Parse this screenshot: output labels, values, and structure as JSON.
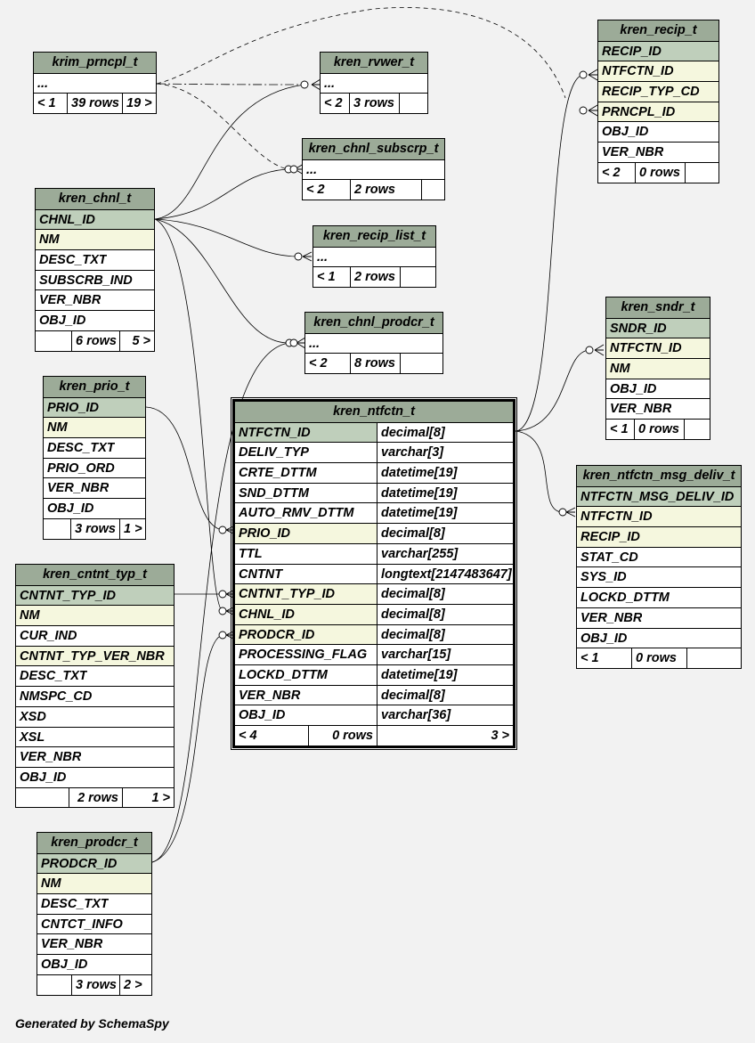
{
  "footer": "Generated by SchemaSpy",
  "tables": {
    "krim_prncpl_t": {
      "name": "krim_prncpl_t",
      "rows": [
        "..."
      ],
      "footer": [
        "< 1",
        "39 rows",
        "19 >"
      ]
    },
    "kren_rvwer_t": {
      "name": "kren_rvwer_t",
      "rows": [
        "..."
      ],
      "footer": [
        "< 2",
        "3 rows",
        ""
      ]
    },
    "kren_chnl_subscrp_t": {
      "name": "kren_chnl_subscrp_t",
      "rows": [
        "..."
      ],
      "footer": [
        "< 2",
        "2 rows",
        ""
      ]
    },
    "kren_recip_list_t": {
      "name": "kren_recip_list_t",
      "rows": [
        "..."
      ],
      "footer": [
        "< 1",
        "2 rows",
        ""
      ]
    },
    "kren_chnl_prodcr_t": {
      "name": "kren_chnl_prodcr_t",
      "rows": [
        "..."
      ],
      "footer": [
        "< 2",
        "8 rows",
        ""
      ]
    },
    "kren_recip_t": {
      "name": "kren_recip_t",
      "rows": [
        "RECIP_ID",
        "NTFCTN_ID",
        "RECIP_TYP_CD",
        "PRNCPL_ID",
        "OBJ_ID",
        "VER_NBR"
      ],
      "footer": [
        "< 2",
        "0 rows",
        ""
      ]
    },
    "kren_chnl_t": {
      "name": "kren_chnl_t",
      "rows": [
        "CHNL_ID",
        "NM",
        "DESC_TXT",
        "SUBSCRB_IND",
        "VER_NBR",
        "OBJ_ID"
      ],
      "footer": [
        "",
        "6 rows",
        "5 >"
      ]
    },
    "kren_sndr_t": {
      "name": "kren_sndr_t",
      "rows": [
        "SNDR_ID",
        "NTFCTN_ID",
        "NM",
        "OBJ_ID",
        "VER_NBR"
      ],
      "footer": [
        "< 1",
        "0 rows",
        ""
      ]
    },
    "kren_prio_t": {
      "name": "kren_prio_t",
      "rows": [
        "PRIO_ID",
        "NM",
        "DESC_TXT",
        "PRIO_ORD",
        "VER_NBR",
        "OBJ_ID"
      ],
      "footer": [
        "",
        "3 rows",
        "1 >"
      ]
    },
    "kren_ntfctn_t": {
      "name": "kren_ntfctn_t",
      "rows": [
        "NTFCTN_ID",
        "DELIV_TYP",
        "CRTE_DTTM",
        "SND_DTTM",
        "AUTO_RMV_DTTM",
        "PRIO_ID",
        "TTL",
        "CNTNT",
        "CNTNT_TYP_ID",
        "CHNL_ID",
        "PRODCR_ID",
        "PROCESSING_FLAG",
        "LOCKD_DTTM",
        "VER_NBR",
        "OBJ_ID"
      ],
      "types": [
        "decimal[8]",
        "varchar[3]",
        "datetime[19]",
        "datetime[19]",
        "datetime[19]",
        "decimal[8]",
        "varchar[255]",
        "longtext[2147483647]",
        "decimal[8]",
        "decimal[8]",
        "decimal[8]",
        "varchar[15]",
        "datetime[19]",
        "decimal[8]",
        "varchar[36]"
      ],
      "footer": [
        "< 4",
        "0 rows",
        "3 >"
      ]
    },
    "kren_ntfctn_msg_deliv_t": {
      "name": "kren_ntfctn_msg_deliv_t",
      "rows": [
        "NTFCTN_MSG_DELIV_ID",
        "NTFCTN_ID",
        "RECIP_ID",
        "STAT_CD",
        "SYS_ID",
        "LOCKD_DTTM",
        "VER_NBR",
        "OBJ_ID"
      ],
      "footer": [
        "< 1",
        "0 rows",
        ""
      ]
    },
    "kren_cntnt_typ_t": {
      "name": "kren_cntnt_typ_t",
      "rows": [
        "CNTNT_TYP_ID",
        "NM",
        "CUR_IND",
        "CNTNT_TYP_VER_NBR",
        "DESC_TXT",
        "NMSPC_CD",
        "XSD",
        "XSL",
        "VER_NBR",
        "OBJ_ID"
      ],
      "footer": [
        "",
        "2 rows",
        "1 >"
      ]
    },
    "kren_prodcr_t": {
      "name": "kren_prodcr_t",
      "rows": [
        "PRODCR_ID",
        "NM",
        "DESC_TXT",
        "CNTCT_INFO",
        "VER_NBR",
        "OBJ_ID"
      ],
      "footer": [
        "",
        "3 rows",
        "2 >"
      ]
    }
  },
  "colors": {
    "background": "#f2f2f2",
    "header": "#9cab98",
    "primary_key": "#bfcfbb",
    "foreign_key": "#f5f7de",
    "plain": "#ffffff"
  }
}
